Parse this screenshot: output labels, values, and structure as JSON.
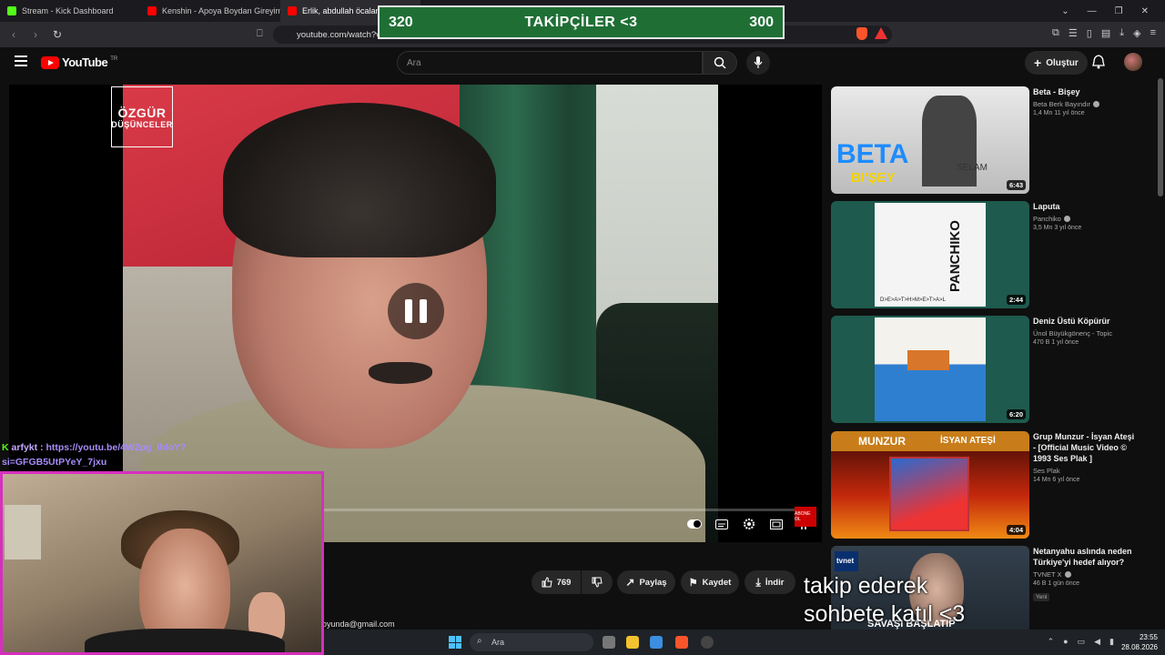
{
  "follower_goal": {
    "current": "320",
    "label": "TAKİPÇİLER <3",
    "target": "300"
  },
  "browser": {
    "tabs": [
      {
        "title": "Stream - Kick Dashboard",
        "color": "#53fc18"
      },
      {
        "title": "Kenshin - Apoya Boydan Gireyim (Elf",
        "color": "#ff0000"
      },
      {
        "title": "Erlik, abdullah öcalana",
        "color": "#ff0000"
      }
    ],
    "url": "youtube.com/watch?v="
  },
  "youtube": {
    "logo_text": "YouTube",
    "region": "TR",
    "search_placeholder": "Ara",
    "create_label": "Oluştur"
  },
  "video": {
    "overlay_logo_line1": "ÖZGÜR",
    "overlay_logo_line2": "DÜŞÜNCELER",
    "subscribe_badge": "ABONE OL",
    "progress": 0.0
  },
  "actions": {
    "like_count": "769",
    "share_label": "Paylaş",
    "save_label": "Kaydet",
    "download_label": "İndir"
  },
  "description_email": "oyunda@gmail.com",
  "recommendations": [
    {
      "title": "Beta - Bişey",
      "channel": "Beta Berk Bayındır",
      "verified": true,
      "stats": "1,4 Mn   11 yıl önce",
      "duration": "6:43",
      "thumb_text": "BETA",
      "thumb_sub": "BI'ŞEY",
      "thumb_extra": "SELAM"
    },
    {
      "title": "Laputa",
      "channel": "Panchiko",
      "verified": true,
      "stats": "3,5 Mn   3 yıl önce",
      "duration": "2:44",
      "thumb_text": "PANCHIKO",
      "thumb_sub": "D>E>A>T>H>M>E>T>A>L",
      "thumb_extra": ""
    },
    {
      "title": "Deniz Üstü Köpürür",
      "channel": "Ünol Büyükgönenç - Topic",
      "verified": false,
      "stats": "470 B   1 yıl önce",
      "duration": "6:20",
      "thumb_text": "",
      "thumb_sub": "",
      "thumb_extra": ""
    },
    {
      "title": "Grup Munzur - İsyan Ateşi - [Official Music Video © 1993 Ses Plak ]",
      "channel": "Ses Plak",
      "verified": false,
      "stats": "14 Mn   6 yıl önce",
      "duration": "4:04",
      "thumb_text": "MUNZUR",
      "thumb_sub": "İSYAN ATEŞİ",
      "thumb_extra": ""
    },
    {
      "title": "Netanyahu aslında neden Türkiye'yi hedef alıyor?",
      "channel": "TVNET X",
      "verified": true,
      "stats": "46 B   1 gün önce",
      "duration": "",
      "badge": "Yeni",
      "thumb_text": "tvnet",
      "thumb_sub": "SAVAŞI BAŞLATIP",
      "thumb_extra": ""
    }
  ],
  "chat": {
    "username": "arfykt",
    "message_line1": "https://youtu.be/4W2pg_lhloY?",
    "message_line2": "si=GFGB5UtPYeY_7jxu"
  },
  "overlay_text": {
    "line1": "takip ederek",
    "line2": "sohbete katıl <3"
  },
  "taskbar": {
    "search_placeholder": "Ara",
    "time": "23:55",
    "date": "28.08.2026"
  }
}
